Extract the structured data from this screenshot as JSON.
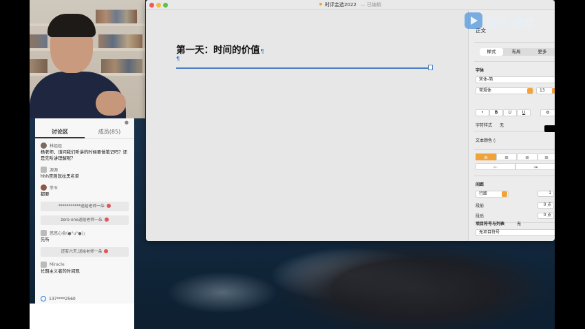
{
  "watermark": {
    "brand": "腾讯课堂"
  },
  "window": {
    "title": "时评金选2022",
    "status": "— 已编辑"
  },
  "document": {
    "heading": "第一天：时间的价值",
    "pilcrow": "¶"
  },
  "inspector": {
    "paragraph_style": "正文",
    "tabs": [
      "样式",
      "布局",
      "更多"
    ],
    "active_tab": 0,
    "font_label": "字体",
    "font_name": "宋体-简",
    "font_weight": "常规体",
    "font_size": "13",
    "style_buttons": [
      "•",
      "B",
      "U",
      "U"
    ],
    "char_style_label": "字符样式",
    "char_style_value": "无",
    "text_color_label": "文本颜色 ◊",
    "text_color": "#000000",
    "align_buttons": [
      "≡",
      "≡",
      "≡",
      "≡"
    ],
    "indent_buttons": [
      "⇤",
      "⇥"
    ],
    "spacing_label": "间距",
    "line_spacing": "行距",
    "line_spacing_value": "1",
    "before_label": "段前",
    "before_value": "0 点",
    "after_label": "段后",
    "after_value": "0 点",
    "bullets_label": "项目符号与列表",
    "bullets_value": "无",
    "bullets_type": "无项目符号",
    "accent_color": "#f0a33a"
  },
  "chat": {
    "tabs": [
      "讨论区",
      "成员(85)"
    ],
    "active_tab": 0,
    "messages": [
      {
        "user": "林姐姐",
        "text": "杨老师，请问我们听讲的时候要做笔记吗？还是先听讲理解呢？"
      },
      {
        "user": "源源",
        "text": "hhh否则就拉黑名单"
      },
      {
        "user": "菲玉",
        "text": "都要"
      }
    ],
    "gifts": [
      "***********送给老师一朵",
      "zero-one送给老师一朵"
    ],
    "messages2": [
      {
        "user": "悠悠心会(●°u°●)」",
        "text": "先听"
      }
    ],
    "gifts2": [
      "还有六天.送给老师一朵"
    ],
    "messages3": [
      {
        "user": "Miracle",
        "text": "长期主义者的时间观"
      }
    ],
    "footer_user": "137****2560"
  }
}
